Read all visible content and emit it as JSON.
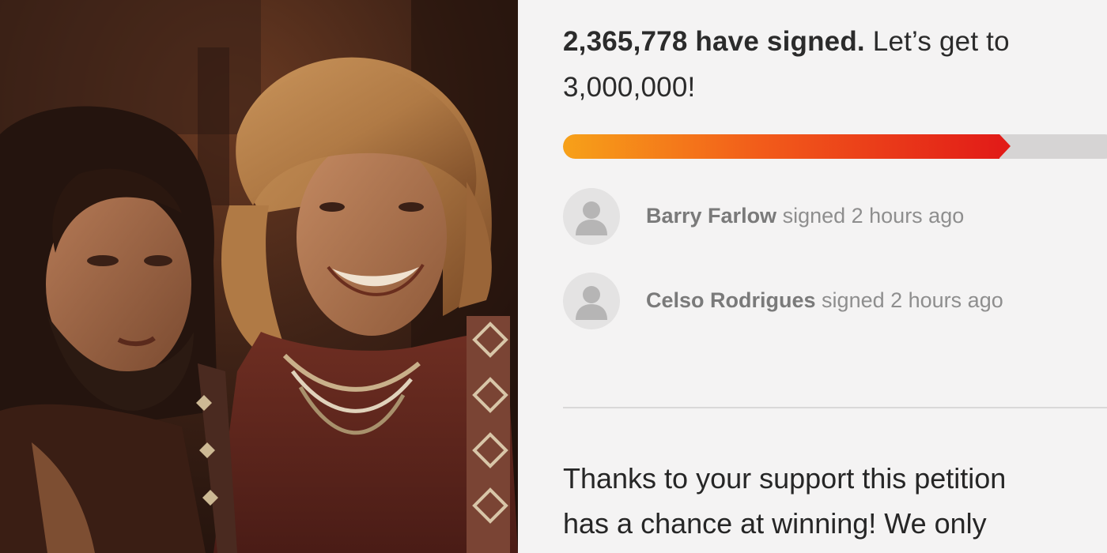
{
  "petition": {
    "signed_count": "2,365,778 have signed.",
    "goal_text": " Let’s get to 3,000,000!",
    "progress_fraction": 0.788,
    "signers": [
      {
        "name": "Barry Farlow",
        "action": " signed 2 hours ago"
      },
      {
        "name": "Celso Rodrigues",
        "action": " signed 2 hours ago"
      }
    ],
    "body_line_1": "Thanks to your support this petition",
    "body_line_2": "has a chance at winning! We only"
  },
  "icons": {
    "avatar": "person-silhouette-icon"
  },
  "colors": {
    "progress_start": "#f7a119",
    "progress_end": "#e21c18",
    "track": "#d6d4d4",
    "panel_bg": "#f4f3f3"
  }
}
